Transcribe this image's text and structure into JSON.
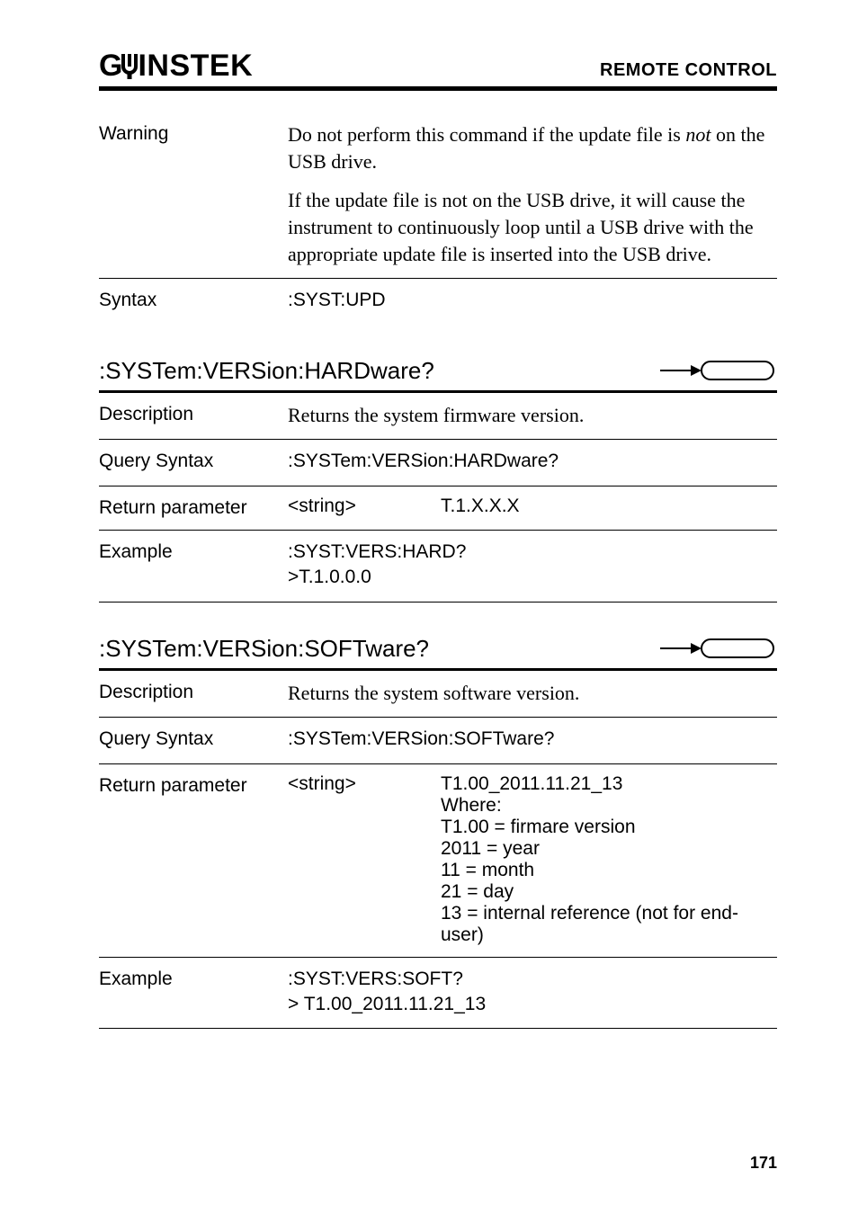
{
  "header": {
    "logo_left": "G",
    "logo_right": "INSTEK",
    "section": "REMOTE CONTROL"
  },
  "warning_block": {
    "label": "Warning",
    "para1_pre": "Do not perform this command if the update file is ",
    "para1_em": "not",
    "para1_post": " on the USB drive.",
    "para2": "If the update file is not on the USB drive, it will cause the instrument to continuously loop until a USB drive with the appropriate update file is inserted into the USB drive."
  },
  "syntax_block": {
    "label": "Syntax",
    "value": ":SYST:UPD"
  },
  "hardware": {
    "title": ":SYSTem:VERSion:HARDware?",
    "description_label": "Description",
    "description_value": "Returns the system firmware version.",
    "query_label": "Query Syntax",
    "query_value": ":SYSTem:VERSion:HARDware?",
    "return_label": "Return parameter",
    "return_type": "<string>",
    "return_ex": "T.1.X.X.X",
    "example_label": "Example",
    "example_l1": ":SYST:VERS:HARD?",
    "example_l2": ">T.1.0.0.0"
  },
  "software": {
    "title": ":SYSTem:VERSion:SOFTware?",
    "description_label": "Description",
    "description_value": "Returns the system software version.",
    "query_label": "Query Syntax",
    "query_value": ":SYSTem:VERSion:SOFTware?",
    "return_label": "Return parameter",
    "return_type": "<string>",
    "lines": [
      "T1.00_2011.11.21_13",
      "Where:",
      "T1.00 = firmare version",
      "2011 = year",
      "11 = month",
      "21 = day",
      "13 = internal reference (not for end-user)"
    ],
    "example_label": "Example",
    "example_l1": ":SYST:VERS:SOFT?",
    "example_l2": "> T1.00_2011.11.21_13"
  },
  "page_number": "171"
}
